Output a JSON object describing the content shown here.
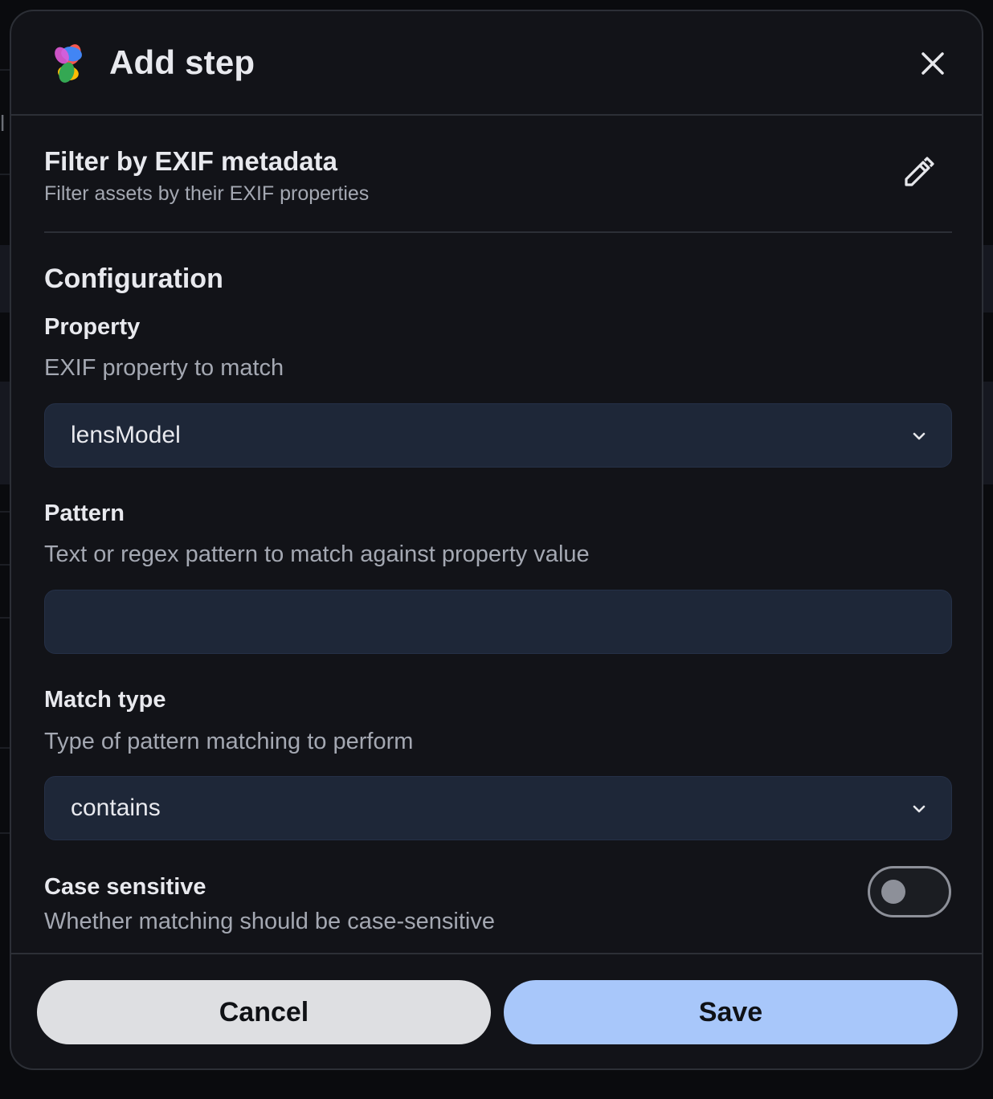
{
  "dialog": {
    "title": "Add step",
    "logo_icon": "pinwheel-logo-icon",
    "close_icon": "close-icon"
  },
  "step": {
    "title": "Filter by EXIF metadata",
    "description": "Filter assets by their EXIF properties",
    "edit_icon": "pencil-icon"
  },
  "configuration": {
    "heading": "Configuration",
    "property": {
      "label": "Property",
      "help": "EXIF property to match",
      "value": "lensModel"
    },
    "pattern": {
      "label": "Pattern",
      "help": "Text or regex pattern to match against property value",
      "value": ""
    },
    "match_type": {
      "label": "Match type",
      "help": "Type of pattern matching to perform",
      "value": "contains"
    },
    "case_sensitive": {
      "label": "Case sensitive",
      "help": "Whether matching should be case-sensitive",
      "enabled": false
    }
  },
  "footer": {
    "cancel_label": "Cancel",
    "save_label": "Save"
  },
  "colors": {
    "dialog_bg": "#121318",
    "field_bg": "#1e2738",
    "save_button": "#a8c7fa",
    "cancel_button": "#dedfe2"
  }
}
